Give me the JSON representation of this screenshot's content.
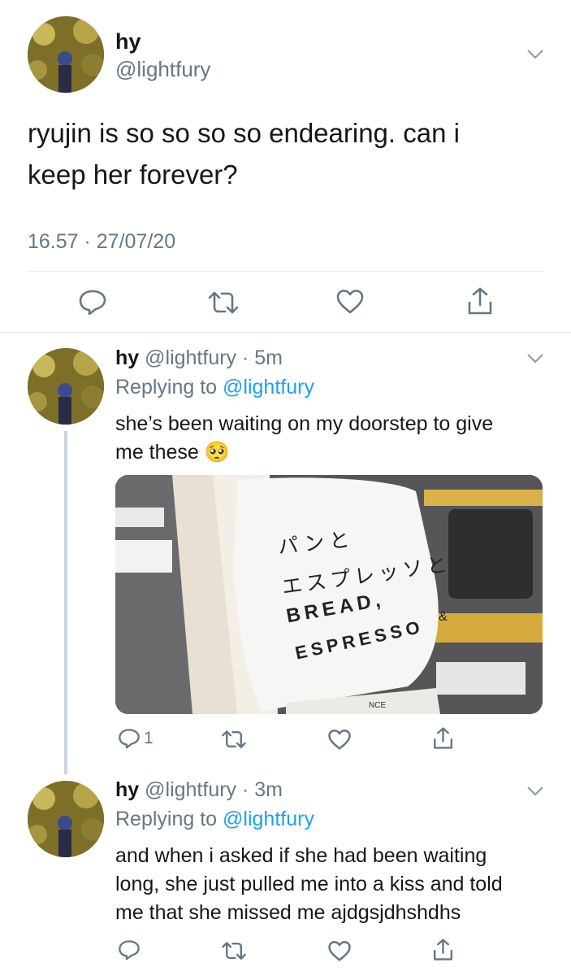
{
  "main_tweet": {
    "name": "hy",
    "handle": "@lightfury",
    "text_line1": "ryujin is so so so so endearing. can i",
    "text_line2": "keep her forever?",
    "timestamp": "16.57 · 27/07/20",
    "icons": [
      "reply-icon",
      "retweet-icon",
      "like-icon",
      "share-icon"
    ]
  },
  "reply1": {
    "name": "hy",
    "handle_time": "@lightfury · 5m",
    "replying_prefix": "Replying to",
    "replying_handle": "@lightfury",
    "text_line1": "she’s been waiting on my doorstep to give",
    "text_line2": "me these",
    "emoji": "🥺",
    "image_texts": {
      "line1": "パンと",
      "line2": "エスプレッソと",
      "line3": "BREAD,",
      "line4": "ESPRESSO",
      "amp": "&",
      "bottom": "NCE"
    },
    "reply_count": "1"
  },
  "reply2": {
    "name": "hy",
    "handle_time": "@lightfury · 3m",
    "replying_prefix": "Replying to",
    "replying_handle": "@lightfury",
    "text_line1": "and when i asked if she had been waiting",
    "text_line2": "long, she just pulled me into a kiss and told",
    "text_line3": "me that she missed me ajdgsjdhshdhs"
  },
  "colors": {
    "text": "#14171a",
    "muted": "#657786",
    "link": "#1da1f2",
    "divider": "#e1e8ed",
    "thread_line": "#ccd6dd"
  }
}
